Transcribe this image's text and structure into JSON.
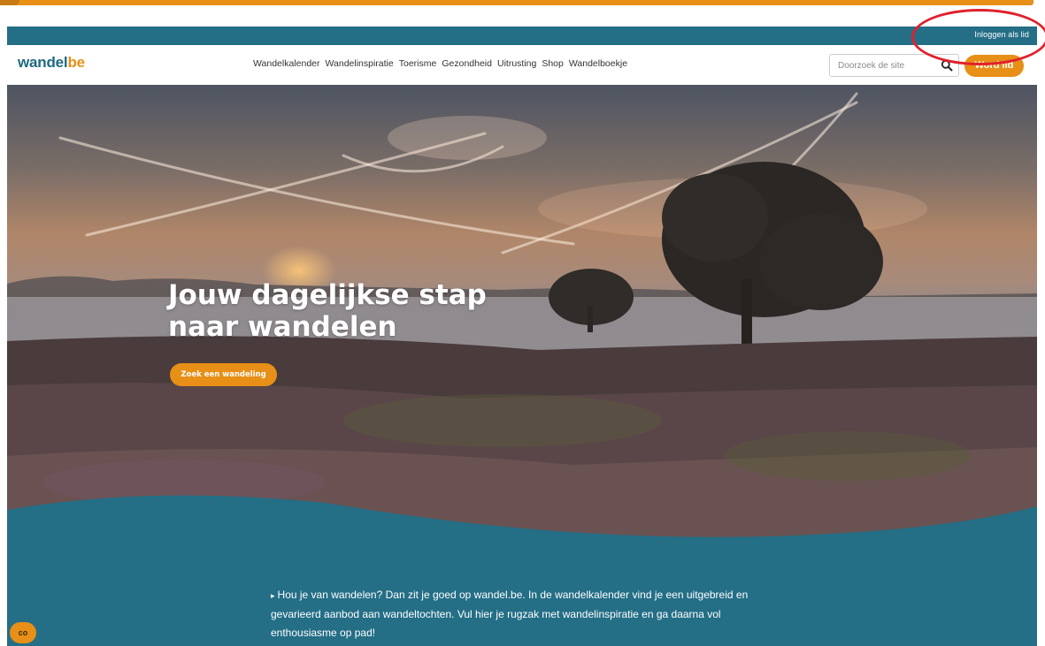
{
  "site": {
    "logo_main": "wandel",
    "logo_accent": "be"
  },
  "utility_bar": {
    "login_label": "Inloggen als lid"
  },
  "nav": {
    "items": [
      {
        "label": "Wandelkalender"
      },
      {
        "label": "Wandelinspiratie"
      },
      {
        "label": "Toerisme"
      },
      {
        "label": "Gezondheid"
      },
      {
        "label": "Uitrusting"
      },
      {
        "label": "Shop"
      },
      {
        "label": "Wandelboekje"
      }
    ],
    "search_placeholder": "Doorzoek de site",
    "search_icon": "search-icon",
    "join_label": "Word lid"
  },
  "hero": {
    "title_line1": "Jouw dagelijkse stap",
    "title_line2": "naar wandelen",
    "cta_label": "Zoek een wandeling"
  },
  "intro": {
    "bullet": "▸",
    "text": "Hou je van wandelen? Dan zit je goed op wandel.be. In de wandelkalender vind je een uitgebreid en gevarieerd aanbod aan wandeltochten. Vul hier je rugzak met wandelinspiratie en ga daarna vol enthousiasme op pad!"
  },
  "cookie_button": {
    "label": "co"
  },
  "colors": {
    "brand_teal": "#246e86",
    "brand_orange": "#e78f16",
    "highlight_red": "#e0212c"
  }
}
